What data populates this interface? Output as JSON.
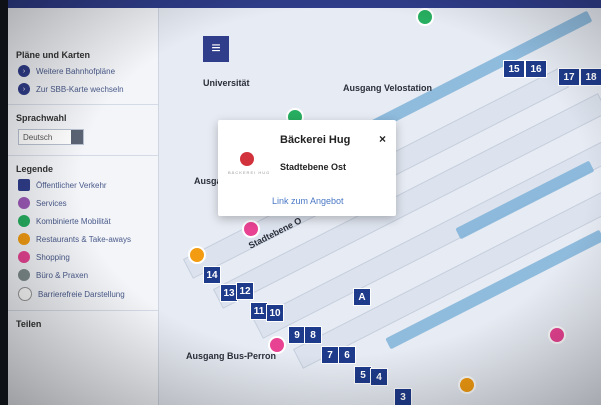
{
  "sidebar": {
    "plans_title": "Pläne und Karten",
    "plans_items": [
      {
        "label": "Weitere Bahnhofpläne",
        "color": "#2f3d8a"
      },
      {
        "label": "Zur SBB-Karte wechseln",
        "color": "#2f3d8a"
      }
    ],
    "language_title": "Sprachwahl",
    "language_value": "Deutsch",
    "legend_title": "Legende",
    "legend_items": [
      {
        "label": "Öffentlicher Verkehr",
        "color": "#2f3d8a"
      },
      {
        "label": "Services",
        "color": "#9b59b6"
      },
      {
        "label": "Kombinierte Mobilität",
        "color": "#27ae60"
      },
      {
        "label": "Restaurants & Take-aways",
        "color": "#f39c12"
      },
      {
        "label": "Shopping",
        "color": "#e84393"
      },
      {
        "label": "Büro & Praxen",
        "color": "#7f8c8d"
      },
      {
        "label": "Barrierefreie Darstellung",
        "color": "#ffffff"
      }
    ],
    "bottom_title": "Teilen"
  },
  "map": {
    "labels": {
      "universitat": "Universität",
      "ausgang_velo": "Ausgang Velostation",
      "ausgang_bus": "Ausgang Bus-Perron",
      "stadtebene_label": "Stadtebene O",
      "ausgang_left": "Ausga"
    },
    "platform_numbers": [
      "14",
      "13",
      "12",
      "11",
      "10",
      "9",
      "8",
      "7",
      "6",
      "5",
      "4",
      "3",
      "A"
    ],
    "top_numbers": [
      "15",
      "16",
      "17",
      "18"
    ]
  },
  "popup": {
    "title": "Bäckerei Hug",
    "close": "×",
    "floor": "Stadtebene Ost",
    "link": "Link zum Angebot",
    "logo_text": "BÄCKEREI HUG"
  },
  "menu_icon": "hamburger-menu-icon"
}
